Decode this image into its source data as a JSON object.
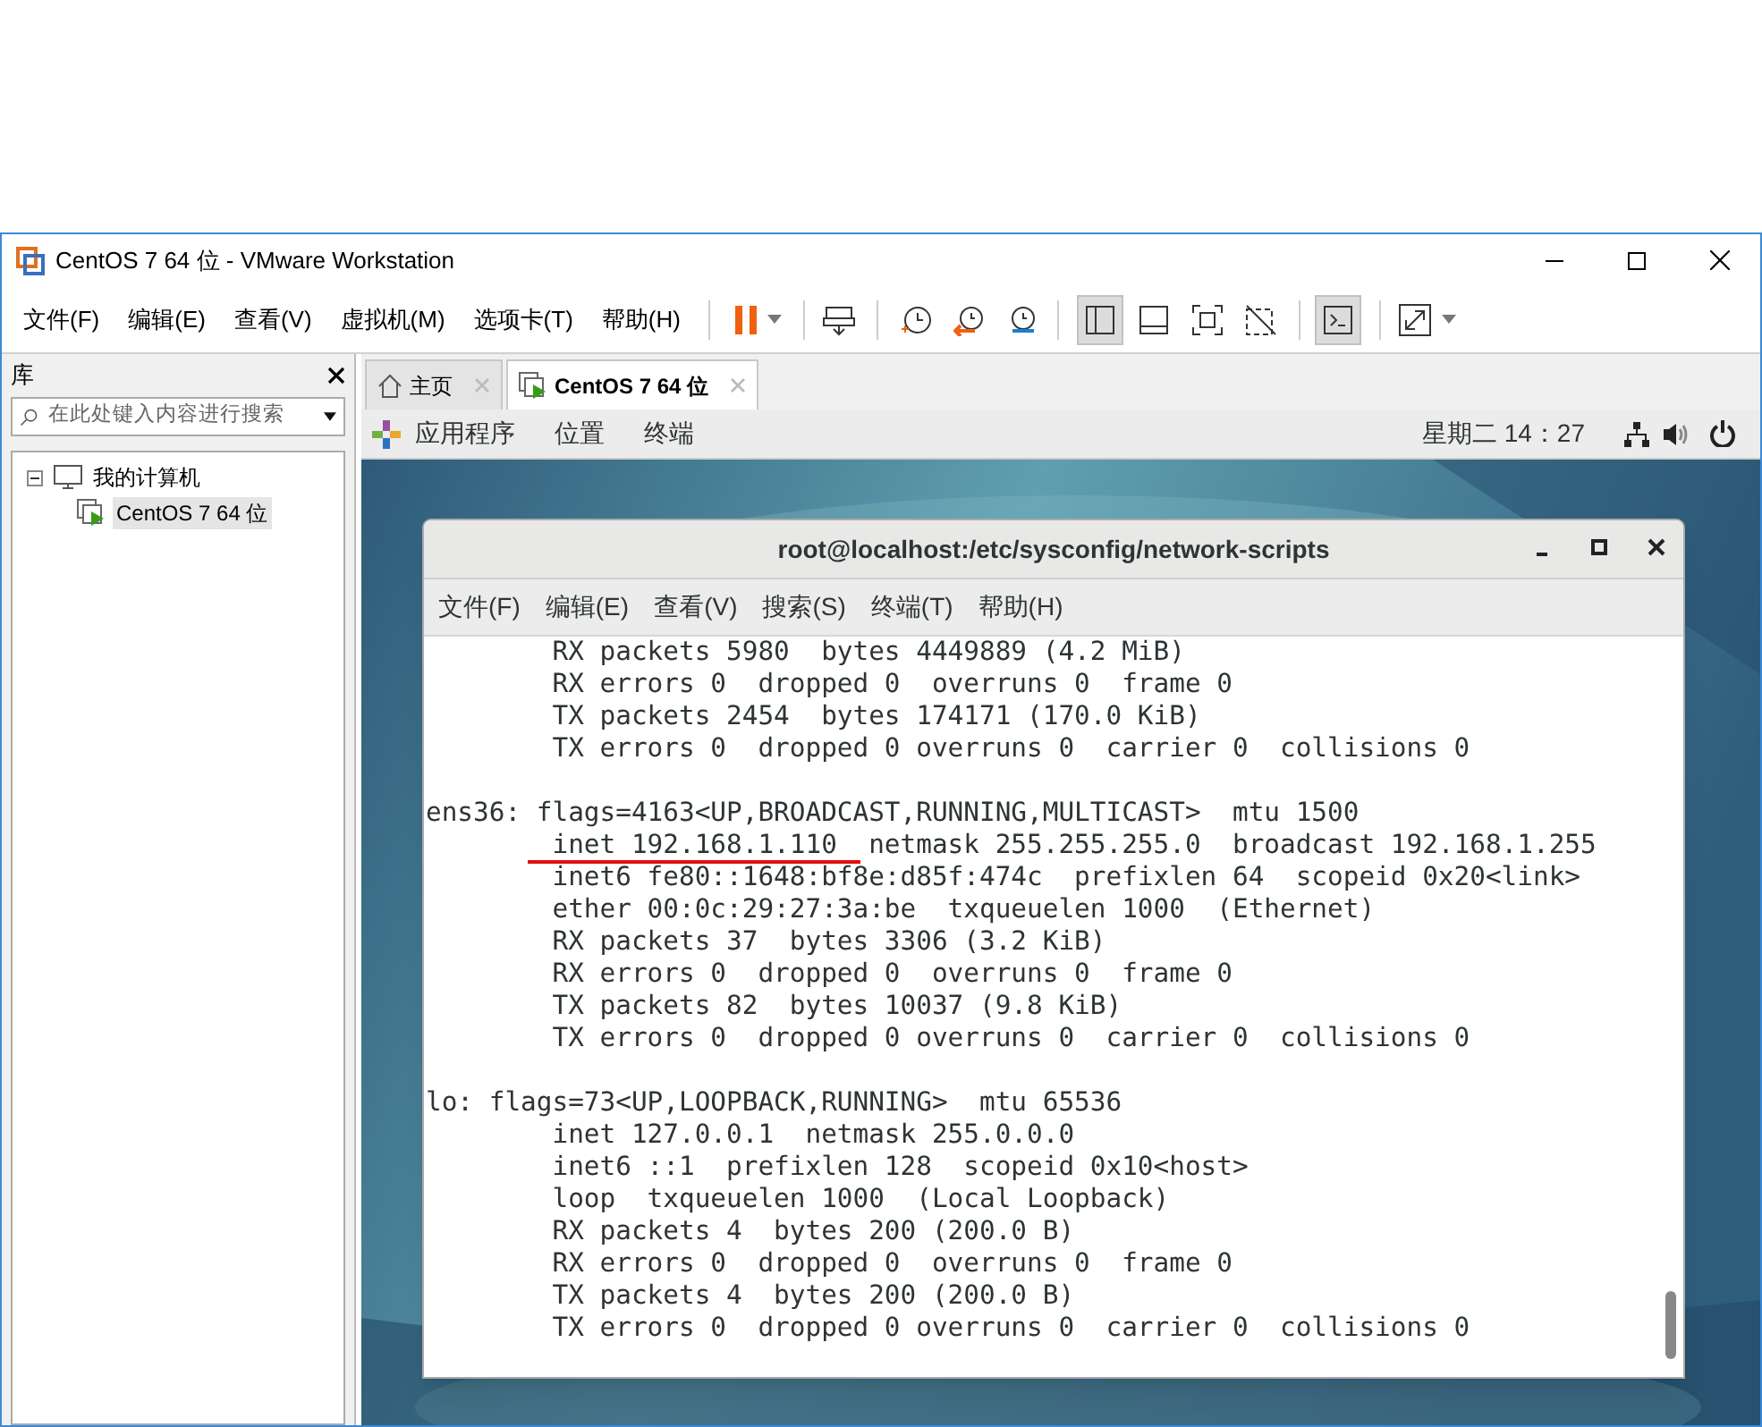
{
  "window": {
    "title": "CentOS 7 64 位 - VMware Workstation"
  },
  "menu": [
    "文件(F)",
    "编辑(E)",
    "查看(V)",
    "虚拟机(M)",
    "选项卡(T)",
    "帮助(H)"
  ],
  "library": {
    "title": "库",
    "search": {
      "placeholder": "在此处键入内容进行搜索"
    },
    "tree": [
      {
        "label": "我的计算机",
        "expanded": true,
        "selected": false,
        "children": [
          {
            "label": "CentOS 7 64 位",
            "selected": true
          }
        ]
      }
    ]
  },
  "tabs": [
    {
      "label": "主页",
      "kind": "home",
      "selected": false
    },
    {
      "label": "CentOS 7 64 位",
      "kind": "vm",
      "selected": true
    }
  ],
  "gnome_bar": {
    "menus": [
      "应用程序",
      "位置",
      "终端"
    ],
    "clock": "星期二 14：27"
  },
  "terminal": {
    "title": "root@localhost:/etc/sysconfig/network-scripts",
    "menu": [
      "文件(F)",
      "编辑(E)",
      "查看(V)",
      "搜索(S)",
      "终端(T)",
      "帮助(H)"
    ],
    "blocks": [
      {
        "lines": [
          "        RX packets 5980  bytes 4449889 (4.2 MiB)",
          "        RX errors 0  dropped 0  overruns 0  frame 0",
          "        TX packets 2454  bytes 174171 (170.0 KiB)",
          "        TX errors 0  dropped 0 overruns 0  carrier 0  collisions 0"
        ]
      },
      {
        "lines": [
          "ens36: flags=4163<UP,BROADCAST,RUNNING,MULTICAST>  mtu 1500",
          "        inet 192.168.1.110  netmask 255.255.255.0  broadcast 192.168.1.255",
          "        inet6 fe80::1648:bf8e:d85f:474c  prefixlen 64  scopeid 0x20<link>",
          "        ether 00:0c:29:27:3a:be  txqueuelen 1000  (Ethernet)",
          "        RX packets 37  bytes 3306 (3.2 KiB)",
          "        RX errors 0  dropped 0  overruns 0  frame 0",
          "        TX packets 82  bytes 10037 (9.8 KiB)",
          "        TX errors 0  dropped 0 overruns 0  carrier 0  collisions 0"
        ]
      },
      {
        "lines": [
          "lo: flags=73<UP,LOOPBACK,RUNNING>  mtu 65536",
          "        inet 127.0.0.1  netmask 255.0.0.0",
          "        inet6 ::1  prefixlen 128  scopeid 0x10<host>",
          "        loop  txqueuelen 1000  (Local Loopback)",
          "        RX packets 4  bytes 200 (200.0 B)",
          "        RX errors 0  dropped 0  overruns 0  frame 0",
          "        TX packets 4  bytes 200 (200.0 B)",
          "        TX errors 0  dropped 0 overruns 0  carrier 0  collisions 0"
        ]
      }
    ]
  }
}
